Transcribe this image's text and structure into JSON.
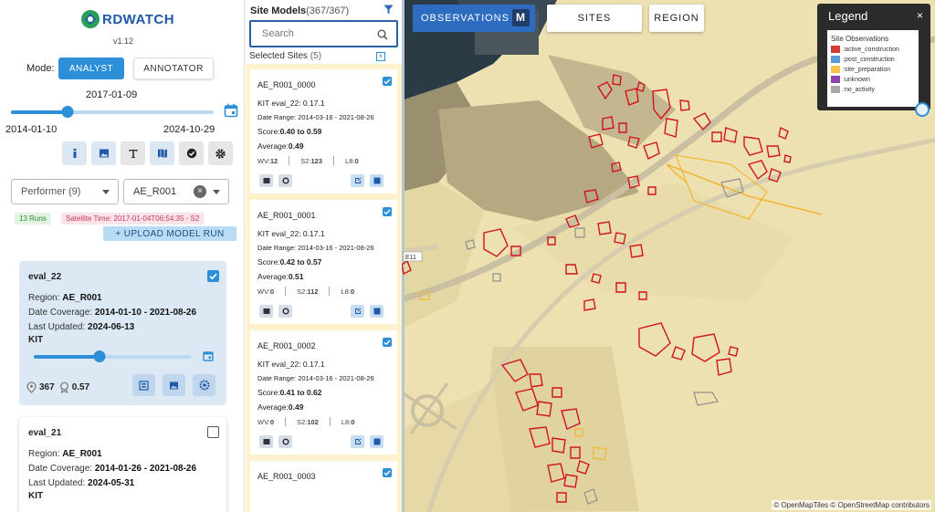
{
  "app": {
    "name": "RDWATCH",
    "version": "v1.12"
  },
  "mode": {
    "label": "Mode:",
    "analyst": "ANALYST",
    "annotator": "ANNOTATOR"
  },
  "timeline": {
    "current_date": "2017-01-09",
    "start_date": "2014-01-10",
    "end_date": "2024-10-29",
    "position": 0.28
  },
  "filters": {
    "performer": "Performer (9)",
    "region": "AE_R001",
    "clear": "×"
  },
  "badges": {
    "runs": "13 Runs",
    "satellite_time": "Satellite Time: 2017-01-04T06:54:35 - S2"
  },
  "upload_button": "+ UPLOAD MODEL RUN",
  "model_runs": [
    {
      "title": "eval_22",
      "region_label": "Region:",
      "region": "AE_R001",
      "coverage_label": "Date Coverage:",
      "coverage": "2014-01-10 - 2021-08-26",
      "updated_label": "Last Updated:",
      "updated": "2024-06-13",
      "performer": "KIT",
      "sites": "367",
      "score": "0.57",
      "checked": true,
      "slider_position": 0.42
    },
    {
      "title": "eval_21",
      "region_label": "Region:",
      "region": "AE_R001",
      "coverage_label": "Date Coverage:",
      "coverage": "2014-01-26 - 2021-08-26",
      "updated_label": "Last Updated:",
      "updated": "2024-05-31",
      "performer": "KIT",
      "checked": false
    }
  ],
  "site_models": {
    "title": "Site Models",
    "count": "(367/367)",
    "search_placeholder": "Search",
    "selected_label": "Selected Sites",
    "selected_count": "(5)",
    "sites": [
      {
        "id": "AE_R001_0000",
        "model": "KIT eval_22: 0.17.1",
        "date_label": "Date Range:",
        "date": "2014-03-16 - 2021-08-26",
        "score_label": "Score:",
        "score": "0.40 to 0.59",
        "avg_label": "Average:",
        "avg": "0.49",
        "wv": "12",
        "s2": "123",
        "l8": "0"
      },
      {
        "id": "AE_R001_0001",
        "model": "KIT eval_22: 0.17.1",
        "date_label": "Date Range:",
        "date": "2014-03-16 - 2021-08-26",
        "score_label": "Score:",
        "score": "0.42 to 0.57",
        "avg_label": "Average:",
        "avg": "0.51",
        "wv": "0",
        "s2": "112",
        "l8": "0"
      },
      {
        "id": "AE_R001_0002",
        "model": "KIT eval_22: 0.17.1",
        "date_label": "Date Range:",
        "date": "2014-03-16 - 2021-08-26",
        "score_label": "Score:",
        "score": "0.41 to 0.62",
        "avg_label": "Average:",
        "avg": "0.49",
        "wv": "0",
        "s2": "102",
        "l8": "0"
      },
      {
        "id": "AE_R001_0003"
      }
    ],
    "count_labels": {
      "wv": "WV:",
      "s2": "S2:",
      "l8": "L8:"
    }
  },
  "map": {
    "observations": "OBSERVATIONS",
    "observations_key": "M",
    "sites": "SITES",
    "region": "REGION",
    "road_label": "E11",
    "attribution": "© OpenMapTiles © OpenStreetMap contributors"
  },
  "legend": {
    "title": "Legend",
    "close": "×",
    "heading": "Site Observations",
    "items": [
      {
        "label": ":active_construction",
        "color": "#d13b33"
      },
      {
        "label": ":post_construction",
        "color": "#5b9bd5"
      },
      {
        "label": ":site_preparation",
        "color": "#f4c542"
      },
      {
        "label": ":unknown",
        "color": "#8e44ad"
      },
      {
        "label": ":no_activity",
        "color": "#a8a8a8"
      }
    ]
  },
  "colors": {
    "accent": "#2d8fd8",
    "active": "#d1121f",
    "site_prep": "#f2b632",
    "no_activity": "#8f8f8f"
  }
}
